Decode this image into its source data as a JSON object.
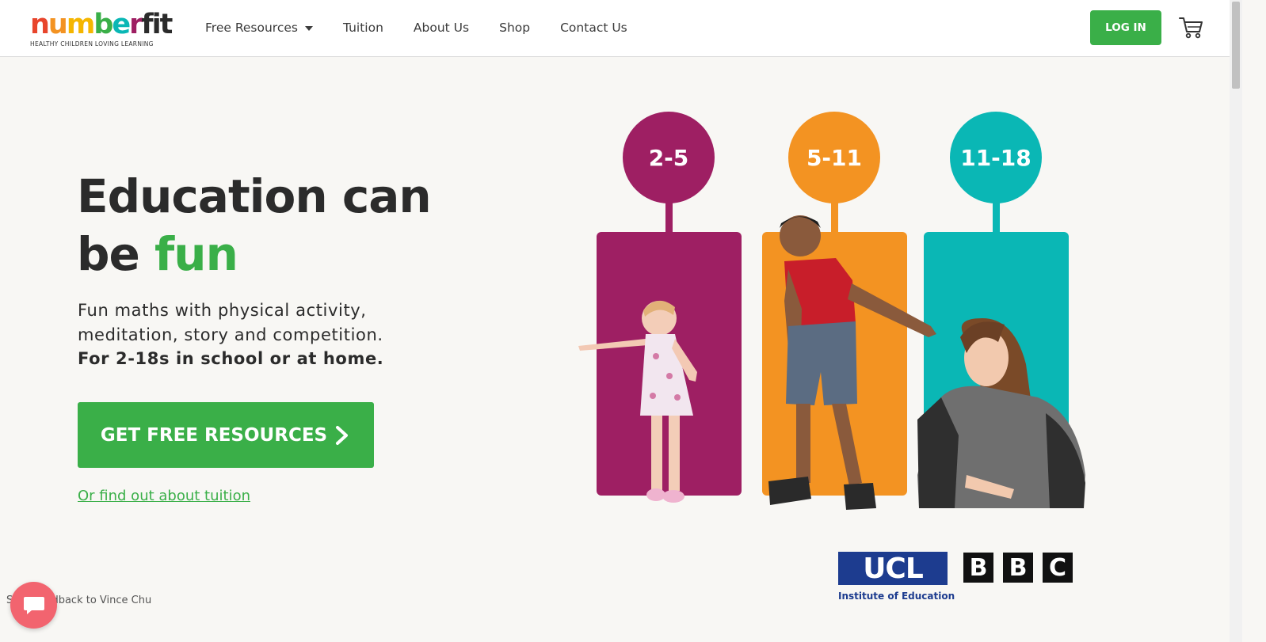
{
  "brand": {
    "logo_letters": [
      {
        "ch": "n",
        "color": "#e8452c"
      },
      {
        "ch": "u",
        "color": "#f39322"
      },
      {
        "ch": "m",
        "color": "#f5b600"
      },
      {
        "ch": "b",
        "color": "#3aaf48"
      },
      {
        "ch": "e",
        "color": "#0ab7b5"
      },
      {
        "ch": "r",
        "color": "#9e1f63"
      },
      {
        "ch": "fit",
        "color": "#2b2b2b"
      }
    ],
    "tagline": "HEALTHY CHILDREN LOVING LEARNING",
    "accent": "#3aaf48"
  },
  "nav": {
    "items": [
      {
        "label": "Free Resources",
        "has_dropdown": true
      },
      {
        "label": "Tuition"
      },
      {
        "label": "About Us"
      },
      {
        "label": "Shop"
      },
      {
        "label": "Contact Us"
      }
    ],
    "login_label": "LOG IN",
    "cart_icon": "cart-icon"
  },
  "hero": {
    "headline_line1": "Education can",
    "headline_be": "be ",
    "headline_fun": "fun",
    "sub_line1": "Fun maths with physical activity,",
    "sub_line2": "meditation, story and competition.",
    "sub_bold": "For 2-18s in school or at home.",
    "cta_label": "GET FREE RESOURCES",
    "secondary_link": "Or find out about tuition"
  },
  "age_groups": [
    {
      "label": "2-5",
      "color": "#9e1f63"
    },
    {
      "label": "5-11",
      "color": "#f39322"
    },
    {
      "label": "11-18",
      "color": "#0ab7b5"
    }
  ],
  "partners": {
    "ucl": {
      "mark": "UCL",
      "sub": "Institute of Education",
      "color": "#1d3c8f"
    },
    "bbc": {
      "letters": [
        "B",
        "B",
        "C"
      ]
    }
  },
  "chat": {
    "note": "Send feedback to Vince Chu",
    "color": "#f2646f"
  }
}
